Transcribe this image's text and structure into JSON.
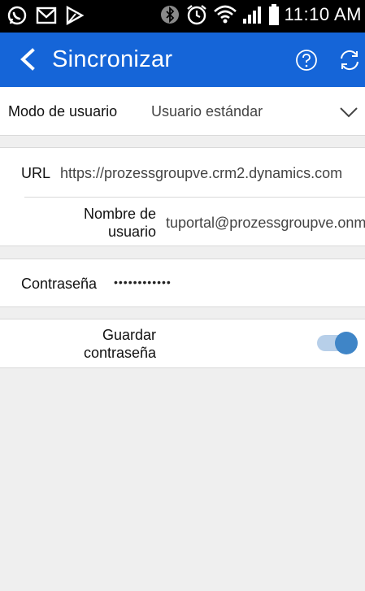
{
  "status_bar": {
    "time": "11:10 AM"
  },
  "app_bar": {
    "title": "Sincronizar"
  },
  "form": {
    "user_mode": {
      "label": "Modo de usuario",
      "value": "Usuario estándar"
    },
    "url": {
      "label": "URL",
      "value": "https://prozessgroupve.crm2.dynamics.com"
    },
    "username": {
      "label_line1": "Nombre de",
      "label_line2": "usuario",
      "value": "tuportal@prozessgroupve.onmicrosoft.com"
    },
    "password": {
      "label": "Contraseña",
      "value": "••••••••••••"
    },
    "save_password": {
      "label_line1": "Guardar",
      "label_line2": "contraseña",
      "enabled": true
    }
  },
  "colors": {
    "app_bar": "#1565d8",
    "toggle_on": "#3f85c7"
  }
}
